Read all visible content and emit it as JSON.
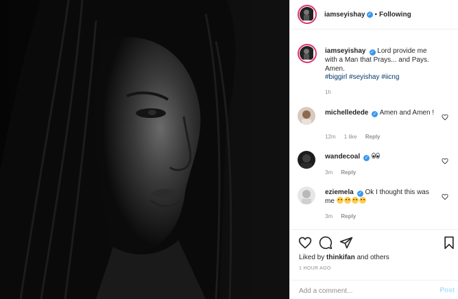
{
  "post": {
    "author": "iamseyishay",
    "follow_status": "Following",
    "dot": "•",
    "caption": "Lord provide me with a Man that Prays... and Pays. Amen.",
    "hashtags": "#biggirl #seyishay #iicng",
    "caption_age": "1h"
  },
  "comments": [
    {
      "user": "michelledede",
      "text": "Amen and Amen !",
      "age": "12m",
      "likes": "1 like",
      "reply": "Reply"
    },
    {
      "user": "wandecoal",
      "text": "",
      "emoji": "eyes",
      "age": "3m",
      "reply": "Reply"
    },
    {
      "user": "eziemela",
      "text": "Ok I thought this was me",
      "emoji": "joy x4",
      "age": "3m",
      "reply": "Reply"
    }
  ],
  "actions": {
    "liked_by_prefix": "Liked by",
    "liked_by_user": "thinkifan",
    "liked_by_suffix": "and others",
    "timestamp": "1 HOUR AGO"
  },
  "add_comment": {
    "placeholder": "Add a comment...",
    "post_label": "Post"
  },
  "colors": {
    "verified": "#3897f0",
    "story_ring": "#e1306c",
    "hashtag": "#00376b",
    "post_disabled": "#b2dffc",
    "muted": "#8e8e8e"
  },
  "icons": [
    "heart-icon",
    "comment-icon",
    "share-icon",
    "bookmark-icon",
    "verified-icon"
  ]
}
